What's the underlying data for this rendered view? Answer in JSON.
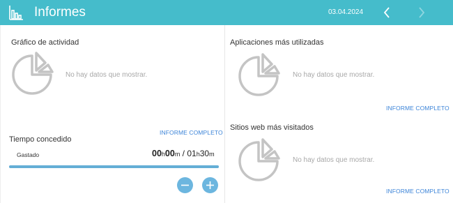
{
  "header": {
    "title": "Informes",
    "date": "03.04.2024",
    "logo_icon": "bar-chart-logo-icon",
    "prev_icon": "chevron-left-icon",
    "next_icon": "chevron-right-icon",
    "background": "#45bccb"
  },
  "activity": {
    "title": "Gráfico de actividad",
    "empty_text": "No hay datos que mostrar.",
    "icon": "pie-chart-icon"
  },
  "apps": {
    "title": "Aplicaciones más utilizadas",
    "empty_text": "No hay datos que mostrar.",
    "link": "INFORME COMPLETO",
    "icon": "pie-chart-icon"
  },
  "sites": {
    "title": "Sitios web más visitados",
    "empty_text": "No hay datos que mostrar.",
    "link": "INFORME COMPLETO",
    "icon": "pie-chart-icon"
  },
  "time": {
    "title": "Tiempo concedido",
    "link": "INFORME COMPLETO",
    "spent_label": "Gastado",
    "spent_hours": "00",
    "spent_minutes": "00",
    "allowed_hours": "01",
    "allowed_minutes": "30",
    "unit_h": "h",
    "unit_m": "m",
    "separator": " / ",
    "progress_fraction": 1.0,
    "minus_icon": "minus-icon",
    "plus_icon": "plus-icon",
    "accent": "#64aed6"
  },
  "colors": {
    "link": "#3c84d8",
    "empty_text": "#a8a8a8",
    "pie_stroke": "#c4c4c4"
  }
}
